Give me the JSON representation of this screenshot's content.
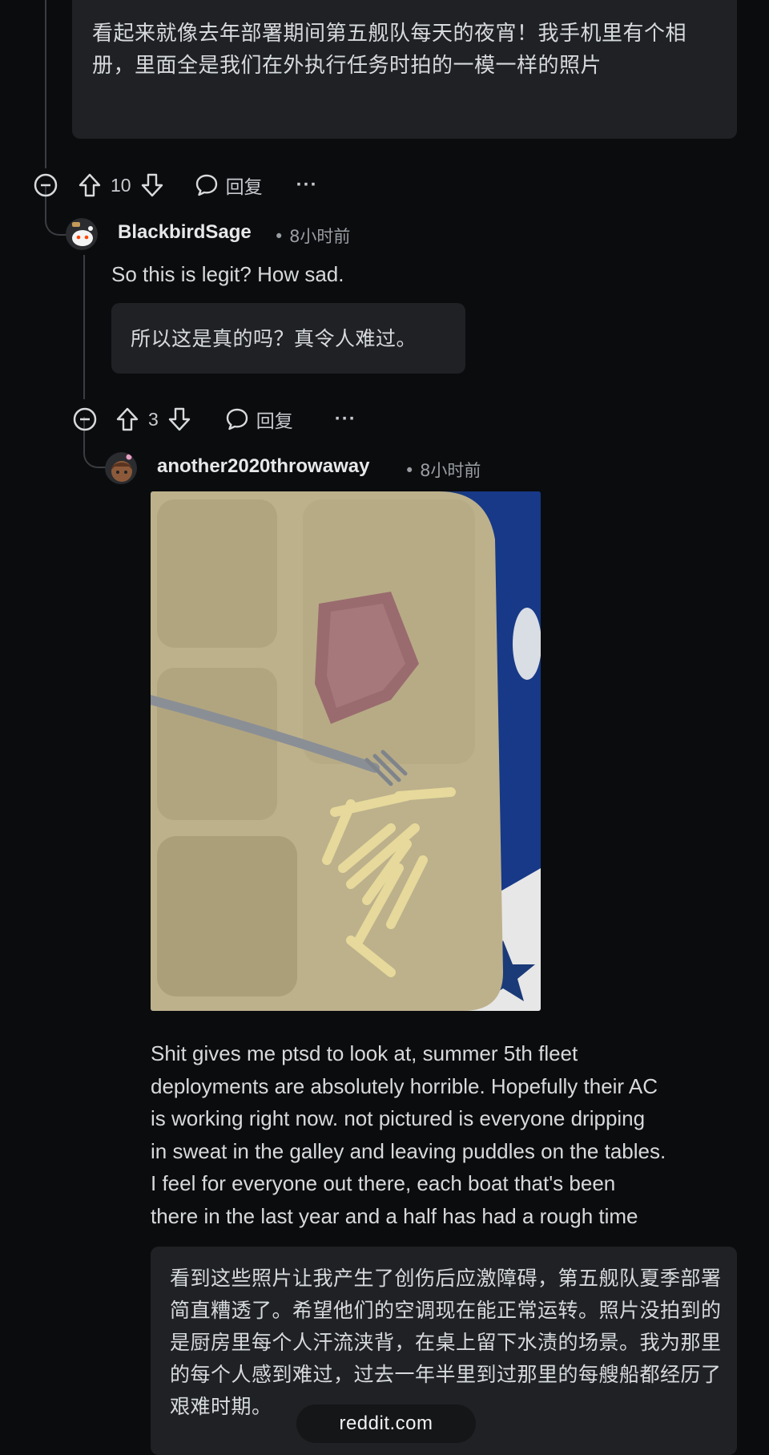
{
  "top_comment": {
    "translation": "看起来就像去年部署期间第五舰队每天的夜宵！我手机里有个相册，里面全是我们在外执行任务时拍的一模一样的照片",
    "vote_count": "10",
    "reply_label": "回复"
  },
  "comment_1": {
    "username": "BlackbirdSage",
    "time": "8小时前",
    "body": "So this is legit? How sad.",
    "translation": "所以这是真的吗？真令人难过。",
    "vote_count": "3",
    "reply_label": "回复"
  },
  "comment_2": {
    "username": "another2020throwaway",
    "time": "8小时前",
    "body_lines": [
      "Shit gives me ptsd to look at, summer 5th fleet",
      "deployments are absolutely horrible. Hopefully their AC",
      "is working right now. not pictured is everyone dripping",
      "in sweat in the galley and leaving puddles on the tables.",
      "I feel for everyone out there, each boat that's been",
      "there in the last year and a half has had a rough time"
    ],
    "translation": "看到这些照片让我产生了创伤后应激障碍，第五舰队夏季部署简直糟透了。希望他们的空调现在能正常运转。照片没拍到的是厨房里每个人汗流浃背，在桌上留下水渍的场景。我为那里的每个人感到难过，过去一年半里到过那里的每艘船都经历了艰难时期。"
  },
  "watermark": "reddit.com",
  "colors": {
    "background": "#0b0c0e",
    "box": "#1f2124",
    "text": "#d7dadc",
    "muted": "#9a9ea3"
  }
}
